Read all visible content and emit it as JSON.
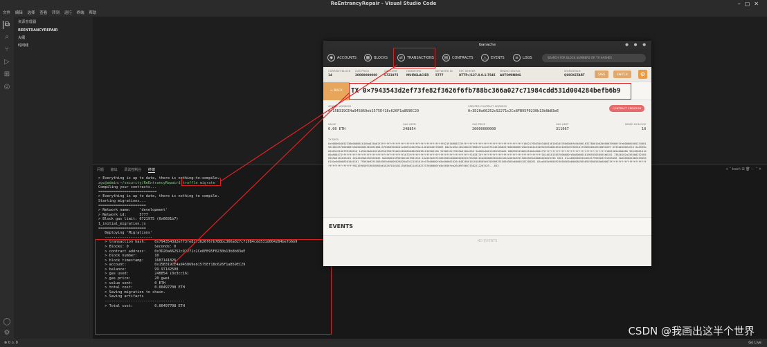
{
  "vscode": {
    "window_title": "ReEntrancyRepair - Visual Studio Code",
    "menu": [
      "文件",
      "编辑",
      "选择",
      "查看",
      "转到",
      "运行",
      "终端",
      "帮助"
    ],
    "sidebar": {
      "header": "资源管理器",
      "items": [
        "REENTRANCYREPAIR",
        "大纲",
        "时间线"
      ]
    },
    "panel_tabs": [
      "问题",
      "输出",
      "调试控制台",
      "终端"
    ],
    "panel_actions": "+ ˅ bash ⊞ 🗑 ⋯ ˄ ✕",
    "status_right": "Go Live"
  },
  "terminal": {
    "lines": [
      "> Everything is up to date, there is nothing to compile.",
      "zgc@admin:~/security/ReEntrancyRepair$ truffle migrate",
      "",
      "Compiling your contracts...",
      "===========================",
      "> Everything is up to date, there is nothing to compile.",
      "",
      "",
      "Starting migrations...",
      "======================",
      "> Network name:    'development'",
      "> Network id:      5777",
      "> Block gas limit: 6721975 (0x6691b7)",
      "",
      "",
      "1_initial_migration.js",
      "======================",
      "",
      "   Deploying 'Migrations'",
      "   ----------------------",
      "   > transaction hash:    0x7943543d2ef73fe82f3626f6fb788bc366a027c71984cdd531d004284befb6b9",
      "   > Blocks: 0            Seconds: 0",
      "   > contract address:    0x3D20a66252c92271c2Ce8FB95F0230b13b8b83eE",
      "   > block number:        10",
      "   > block timestamp:     1687141826",
      "   > account:             0x15B319CE4a945869eb1575Ef18c626F1a859EC29",
      "   > balance:             99.97142508",
      "   > gas used:            248854 (0x3cc16)",
      "   > gas price:           20 gwei",
      "   > value sent:          0 ETH",
      "   > total cost:          0.00497708 ETH",
      "",
      "   > Saving migration to chain.",
      "   > Saving artifacts",
      "   -------------------------------------",
      "   > Total cost:          0.00497708 ETH"
    ]
  },
  "ganache": {
    "title": "Ganache",
    "nav": [
      "ACCOUNTS",
      "BLOCKS",
      "TRANSACTIONS",
      "CONTRACTS",
      "EVENTS",
      "LOGS"
    ],
    "search_placeholder": "SEARCH FOR BLOCK NUMBERS OR TX HASHES",
    "info": [
      {
        "label": "CURRENT BLOCK",
        "value": "14"
      },
      {
        "label": "GAS PRICE",
        "value": "20000000000"
      },
      {
        "label": "GAS LIMIT",
        "value": "6721975"
      },
      {
        "label": "HARDFORK",
        "value": "MUIRGLACIER"
      },
      {
        "label": "NETWORK ID",
        "value": "5777"
      },
      {
        "label": "RPC SERVER",
        "value": "HTTP://127.0.0.1:7545"
      },
      {
        "label": "MINING STATUS",
        "value": "AUTOMINING"
      }
    ],
    "workspace_label": "WORKSPACE",
    "workspace_value": "QUICKSTART",
    "save_label": "SAVE",
    "switch_label": "SWITCH",
    "back_label": "← BACK",
    "tx_hash": "TX 0×7943543d2ef73fe82f3626f6fb788bc366a027c71984cdd531d004284befb6b9",
    "sender_label": "SENDER ADDRESS",
    "sender": "0×15B319CE4a945869eb1575Ef18c626F1a859EC29",
    "created_label": "CREATED CONTRACT ADDRESS",
    "created": "0×3D20a66252c92271c2Ce8FB95F0230b13b8b83eE",
    "pill": "CONTRACT CREATION",
    "value_label": "VALUE",
    "value": "0.00 ETH",
    "gas_used_label": "GAS USED",
    "gas_used": "248854",
    "gas_price_label": "GAS PRICE",
    "gas_price": "20000000000",
    "gas_limit_label": "GAS LIMIT",
    "gas_limit": "311067",
    "mined_label": "MINED IN BLOCK",
    "mined": "10",
    "txdata_label": "TX DATA",
    "txdata": "0×608060405233600080610100a815b81f3ffffffffffffffffffffffffffffffffffffffff021916908373ffffffffffffffffffffffffffffffffffffffff16021790555034801561001057600080fd5b5061032780610020600039600f3fe608060405234801561001057600080fd5b50600436106100415760003560e01c8063445df0ac14610046578063 8da5cb5b146100645780063fdaed576146100825760008080fd5b61004e61009e565b60405161005b91906101f0565b6040518091039 0f35b61006c610 0a4565b6040516100799190610 1d5565b60405180910390f35b610096600480360381010906100 91906101f9565b6100c856 5b005b60015481565b60 00809054906101000a900473ffffffffffffffffffffffffffffffffffffffff1681565b600080 9054906101000a900473ffffffffffffffffffffffffffffffffffffffff1673ffffffffffffffffffffffffffffffffffffffff163373ffffffffffffffffffffffffffffffffffffffff161461015657600080fd5b8060018190555050565b6101 73816102a2565b82525050565b6101828161 02b4565b8252505056 5b60008135905061019581610 2da565b92915050565b60006020820190506101b0600083018461016a565b92915050565b60006020820190 5061 01cb6000830184610179565b9291505056 5b60006020820190506101e660008301846101 79565b92915050565b6000602082840312156101fe57600080fd5b600061020c84828501610186565b91505092915050565b60006102208261 02aa565b9050919050565b6000819050919050565b600073ffffffffffffffffffffffffffffffffffffffff82169050919050565b61026781610215565b811461027257600080fd5b5056fea26469706673582212207425...033",
    "events_label": "EVENTS",
    "no_events": "NO EVENTS"
  },
  "watermark": "CSDN @我画出这半个世界"
}
